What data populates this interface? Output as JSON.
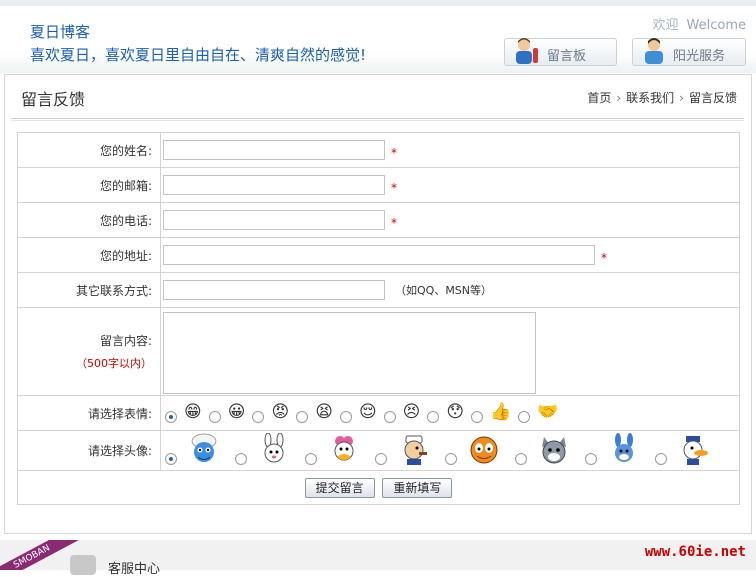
{
  "header": {
    "site_name": "夏日博客",
    "slogan": "喜欢夏日，喜欢夏日里自由自在、清爽自然的感觉!",
    "welcome_cn": "欢迎",
    "welcome_en": "Welcome",
    "btn_guestbook": "留言板",
    "btn_service": "阳光服务"
  },
  "page": {
    "title": "留言反馈",
    "breadcrumb": [
      "首页",
      "联系我们",
      "留言反馈"
    ],
    "breadcrumb_sep": "›"
  },
  "form": {
    "name_label": "您的姓名:",
    "email_label": "您的邮箱:",
    "phone_label": "您的电话:",
    "address_label": "您的地址:",
    "other_label": "其它联系方式:",
    "other_hint": "（如QQ、MSN等）",
    "message_label": "留言内容:",
    "message_limit": "（500字以内）",
    "emotion_label": "请选择表情:",
    "avatar_label": "请选择头像:",
    "required_mark": "*",
    "name_value": "",
    "email_value": "",
    "phone_value": "",
    "address_value": "",
    "other_value": "",
    "message_value": "",
    "emotions": [
      "😁",
      "😀",
      "😡",
      "😫",
      "😌",
      "😣",
      "😯",
      "👍",
      "🤝"
    ],
    "avatars": [
      "smurf",
      "rabbit",
      "duck-girl",
      "popeye",
      "garfield",
      "tom",
      "buster",
      "donald"
    ],
    "selected_emotion": 0,
    "selected_avatar": 0,
    "submit_label": "提交留言",
    "reset_label": "重新填写"
  },
  "footer": {
    "ribbon": "SMOBAN",
    "service_label": "客服中心",
    "watermark": "www.60ie.net"
  }
}
